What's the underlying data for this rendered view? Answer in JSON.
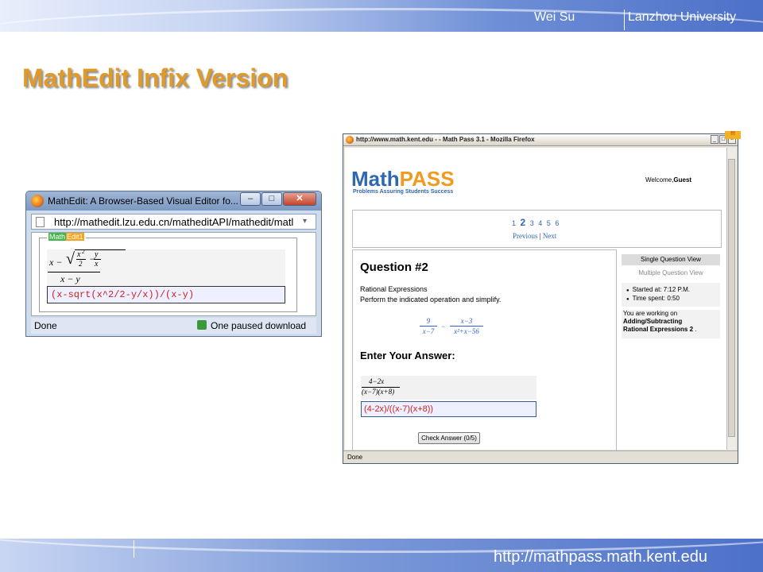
{
  "header": {
    "author": "Wei Su",
    "university": "Lanzhou University"
  },
  "slide": {
    "title": "MathEdit Infix Version"
  },
  "footer": {
    "url": "http://mathpass.math.kent.edu"
  },
  "mathedit_window": {
    "title": "MathEdit: A Browser-Based Visual Editor fo...",
    "address": "http://mathedit.lzu.edu.cn/matheditAPI/mathedit/matl",
    "editor_label_a": "Math",
    "editor_label_b": "Edit1",
    "formula": {
      "x_minus": "x −",
      "x2": "x",
      "sup2": "2",
      "den2": "2",
      "minus": "−",
      "y": "y",
      "x": "x",
      "denominator": "x − y"
    },
    "infix_value": "(x-sqrt(x^2/2-y/x))/(x-y)",
    "status_done": "Done",
    "status_download": "One paused download",
    "buttons": {
      "min": "–",
      "max": "□",
      "close": "✕"
    }
  },
  "mathpass_window": {
    "title": "http://www.math.kent.edu - - Math Pass 3.1 - Mozilla Firefox",
    "corner_tag": "!!!",
    "logo_math": "Math",
    "logo_pass": "PASS",
    "tagline": "Problems Assuring Students Success",
    "welcome_prefix": "Welcome,",
    "welcome_user": "Guest",
    "pages": [
      "1",
      "2",
      "3",
      "4",
      "5",
      "6"
    ],
    "prev": "Previous",
    "sep": "|",
    "next": "Next",
    "question_title": "Question #2",
    "topic": "Rational Expressions",
    "instruction": "Perform the indicated operation and simplify.",
    "expression": {
      "n1": "9",
      "d1": "x−7",
      "op": "−",
      "n2": "x−3",
      "d2": "x²+x−56"
    },
    "answer_title": "Enter Your Answer:",
    "answer_render": {
      "num": "4−2x",
      "den": "(x−7)(x+8)"
    },
    "answer_value": "(4-2x)/((x-7)(x+8))",
    "check_button": "Check Answer (0/5)",
    "side": {
      "single_view": "Single Question View",
      "multiple_view": "Multiple Question View",
      "started": "Started at: 7:12 P.M.",
      "spent": "Time spent: 0:50",
      "working_on": "You are working on",
      "section_line1": "Adding/Subtracting",
      "section_line2": "Rational Expressions 2",
      "period": "."
    },
    "status": "Done"
  }
}
